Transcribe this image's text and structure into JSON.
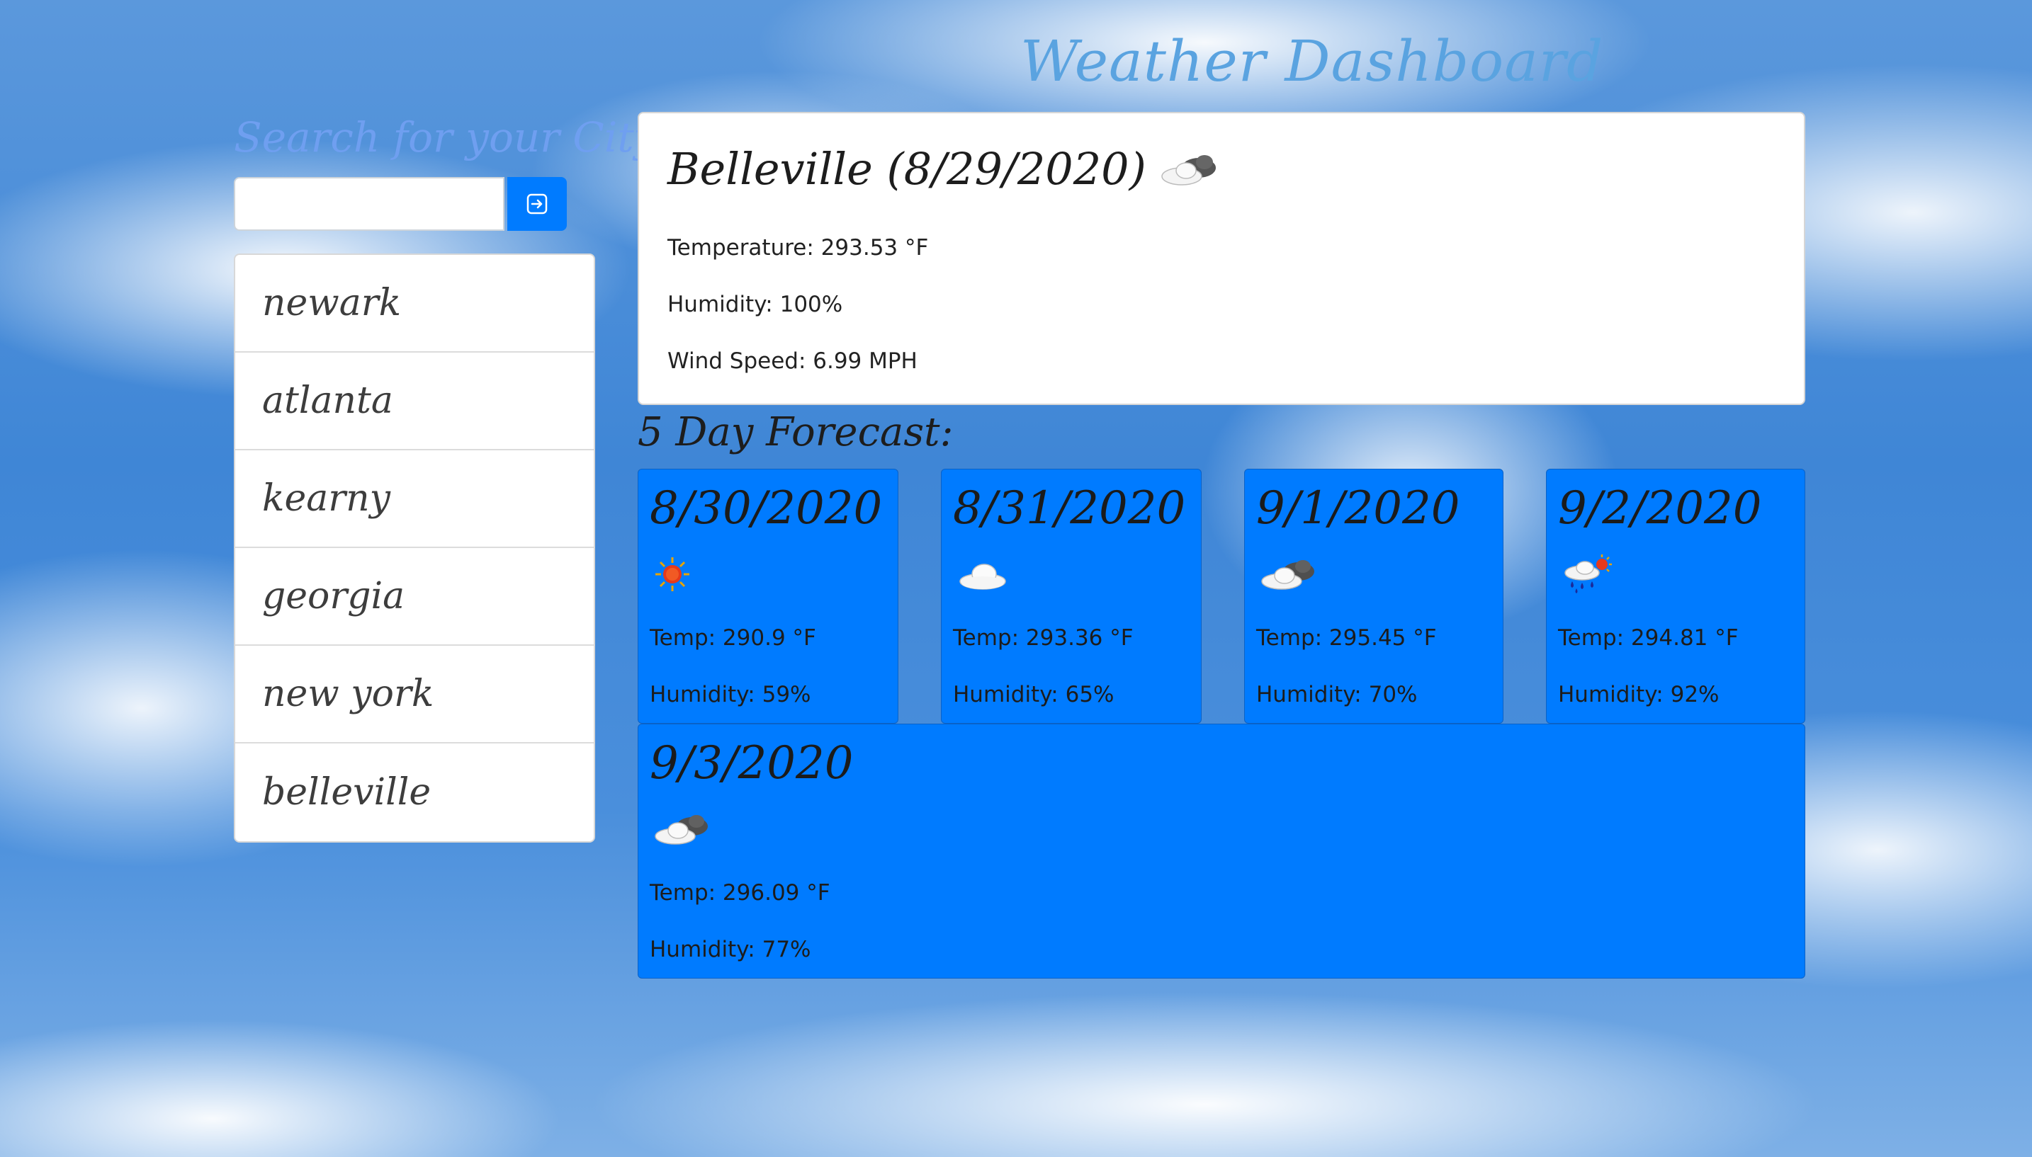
{
  "header": {
    "title": "Weather Dashboard"
  },
  "search": {
    "heading": "Search for your City:",
    "value": "",
    "placeholder": "",
    "button_icon": "arrow-right-icon"
  },
  "cities": [
    "newark",
    "atlanta",
    "kearny",
    "georgia",
    "new york",
    "belleville"
  ],
  "current": {
    "heading": "Belleville (8/29/2020)",
    "icon": "cloud-dark-icon",
    "temperature": "Temperature: 293.53 °F",
    "humidity": "Humidity: 100%",
    "wind": "Wind Speed: 6.99 MPH"
  },
  "forecast": {
    "heading": "5 Day Forecast:",
    "days": [
      {
        "date": "8/30/2020",
        "icon": "sun-icon",
        "temp": "Temp: 290.9 °F",
        "humidity": "Humidity: 59%"
      },
      {
        "date": "8/31/2020",
        "icon": "cloud-icon",
        "temp": "Temp: 293.36 °F",
        "humidity": "Humidity: 65%"
      },
      {
        "date": "9/1/2020",
        "icon": "cloud-dark-icon",
        "temp": "Temp: 295.45 °F",
        "humidity": "Humidity: 70%"
      },
      {
        "date": "9/2/2020",
        "icon": "rain-sun-icon",
        "temp": "Temp: 294.81 °F",
        "humidity": "Humidity: 92%"
      },
      {
        "date": "9/3/2020",
        "icon": "cloud-dark-icon",
        "temp": "Temp: 296.09 °F",
        "humidity": "Humidity: 77%"
      }
    ]
  },
  "colors": {
    "accent": "#007bff",
    "title": "#5aa3e0",
    "search_heading": "#6f9ff0"
  }
}
